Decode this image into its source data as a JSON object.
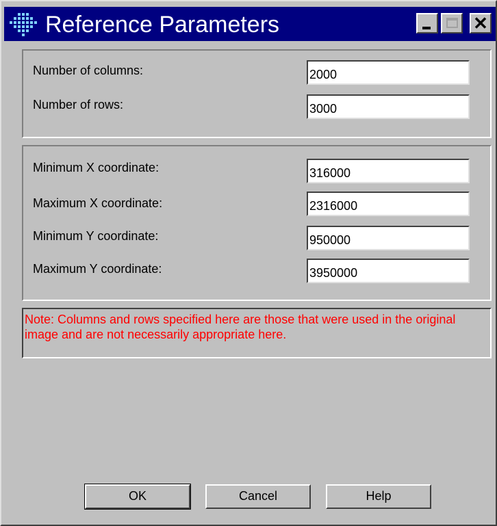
{
  "window": {
    "title": "Reference Parameters",
    "icon": "grid-app-icon",
    "controls": {
      "minimize": "minimize-icon",
      "maximize": "maximize-icon",
      "close_glyph": "✕"
    }
  },
  "grid": {
    "columns_label": "Number of columns:",
    "columns_value": "2000",
    "rows_label": "Number of rows:",
    "rows_value": "3000"
  },
  "coordinates": {
    "min_x_label": "Minimum X coordinate:",
    "min_x_value": "316000",
    "max_x_label": "Maximum X coordinate:",
    "max_x_value": "2316000",
    "min_y_label": "Minimum Y coordinate:",
    "min_y_value": "950000",
    "max_y_label": "Maximum Y coordinate:",
    "max_y_value": "3950000"
  },
  "note": {
    "text": "Note: Columns and rows specified here are those that were used in the original image and are not necessarily appropriate here.",
    "color": "#ff0000"
  },
  "buttons": {
    "ok": "OK",
    "cancel": "Cancel",
    "help": "Help"
  },
  "colors": {
    "titlebar": "#000080",
    "face": "#c0c0c0"
  }
}
